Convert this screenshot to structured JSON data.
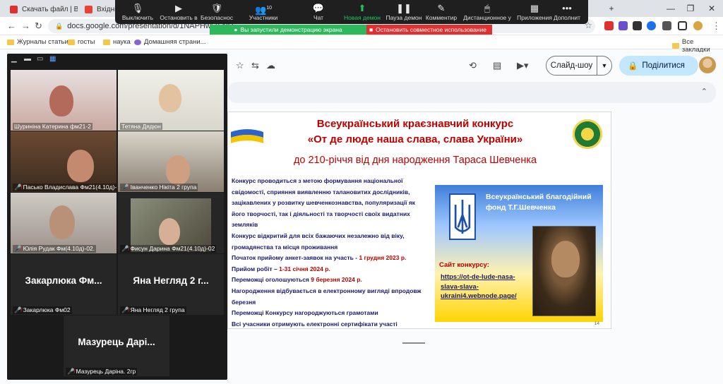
{
  "tabs": [
    {
      "label": "Скачать файл | В",
      "color": "#e03131"
    },
    {
      "label": "Вхідні (",
      "color": "#ea4335"
    }
  ],
  "window_controls": {
    "minimize": "—",
    "restore": "❐",
    "close": "✕"
  },
  "address": {
    "url": "docs.google.com/presentation/d/1NAPHw6u-NU"
  },
  "bookmarks": [
    "Журналы статьи",
    "госты",
    "наука",
    "Домашняя страни...",
    "Все закладки"
  ],
  "zoom_toolbar": {
    "buttons": [
      {
        "label": "Выключить",
        "icon": "🎤"
      },
      {
        "label": "Остановить в",
        "icon": "▶"
      },
      {
        "label": "Безопаснос",
        "icon": "🛡"
      },
      {
        "label": "Участники",
        "icon": "👥",
        "count": "10"
      },
      {
        "label": "Чат",
        "icon": "💬"
      },
      {
        "label": "Новая демон",
        "icon": "⬆"
      },
      {
        "label": "Пауза демон",
        "icon": "❚❚"
      },
      {
        "label": "Комментир",
        "icon": "✎"
      },
      {
        "label": "Дистанционное у",
        "icon": "🖱"
      },
      {
        "label": "Приложения",
        "icon": "▦"
      },
      {
        "label": "Дополнит",
        "icon": "•••"
      }
    ],
    "banner_share": "Вы запустили демонстрацию экрана",
    "banner_stop": "Остановить совместное использование"
  },
  "slides_toolbar": {
    "slideshow": "Слайд-шоу",
    "share": "Поділитися"
  },
  "slide": {
    "title1": "Всеукраїнський краєзнавчий конкурс",
    "title2": "«От де люде наша слава, слава України»",
    "subtitle": "до 210-річчя від дня народження Тараса Шевченка",
    "p1": "Конкурс проводиться з метою формування національної свідомості, сприяння виявленню талановитих дослідників, зацікавлених у розвитку шевченкознавства, популяризації як його творчості, так і діяльності та творчості своїх видатних земляків",
    "p2": "Конкурс відкритий для всіх бажаючих незалежно від віку, громадянства та місця проживання",
    "p3_pre": "Початок прийому анкет-заявок на участь - ",
    "p3_date": "1 грудня 2023 р.",
    "p4_pre": "Прийом робіт – ",
    "p4_date": "1-31 січня 2024 р.",
    "p5_pre": "Переможці оголошуються ",
    "p5_date": "9 березня 2024 р.",
    "p6": "Нагородження відбувається в електронному вигляді впродовж березня",
    "p7": "Переможці Конкурсу нагороджуються грамотами",
    "p8": "Всі учасники отримують електронні сертифікати участі",
    "fund": "Всеукраїнський благодійний фонд Т.Г.Шевченка",
    "site_label": "Сайт конкурсу:",
    "site_url": "https://ot-de-lude-nasa-slava-slava-ukraini4.webnode.page/",
    "page": "14"
  },
  "participants": [
    {
      "name": "Шуриніна Катерина фм21-2",
      "muted": false,
      "video": true
    },
    {
      "name": "Тетяна Дядюн",
      "muted": false,
      "video": true
    },
    {
      "name": "Пасько Владислава Фм21(4.10д)-...",
      "muted": true,
      "video": true
    },
    {
      "name": "Іванченко Нікіта 2 група",
      "muted": true,
      "video": true
    },
    {
      "name": "Юлія Рудак Фм(4.10д)-02.",
      "muted": true,
      "video": true
    },
    {
      "name": "Фисун Дарина Фм21(4.10д)-02",
      "muted": true,
      "video": true
    },
    {
      "name": "Закарлюка Фм02",
      "big": "Закарлюка  Фм...",
      "muted": true,
      "video": false
    },
    {
      "name": "Яна Негляд 2 група",
      "big": "Яна Негляд 2 г...",
      "muted": true,
      "video": false
    },
    {
      "name": "Мазурець Даріна. 2гр",
      "big": "Мазурець Дарі...",
      "muted": true,
      "video": false
    }
  ]
}
